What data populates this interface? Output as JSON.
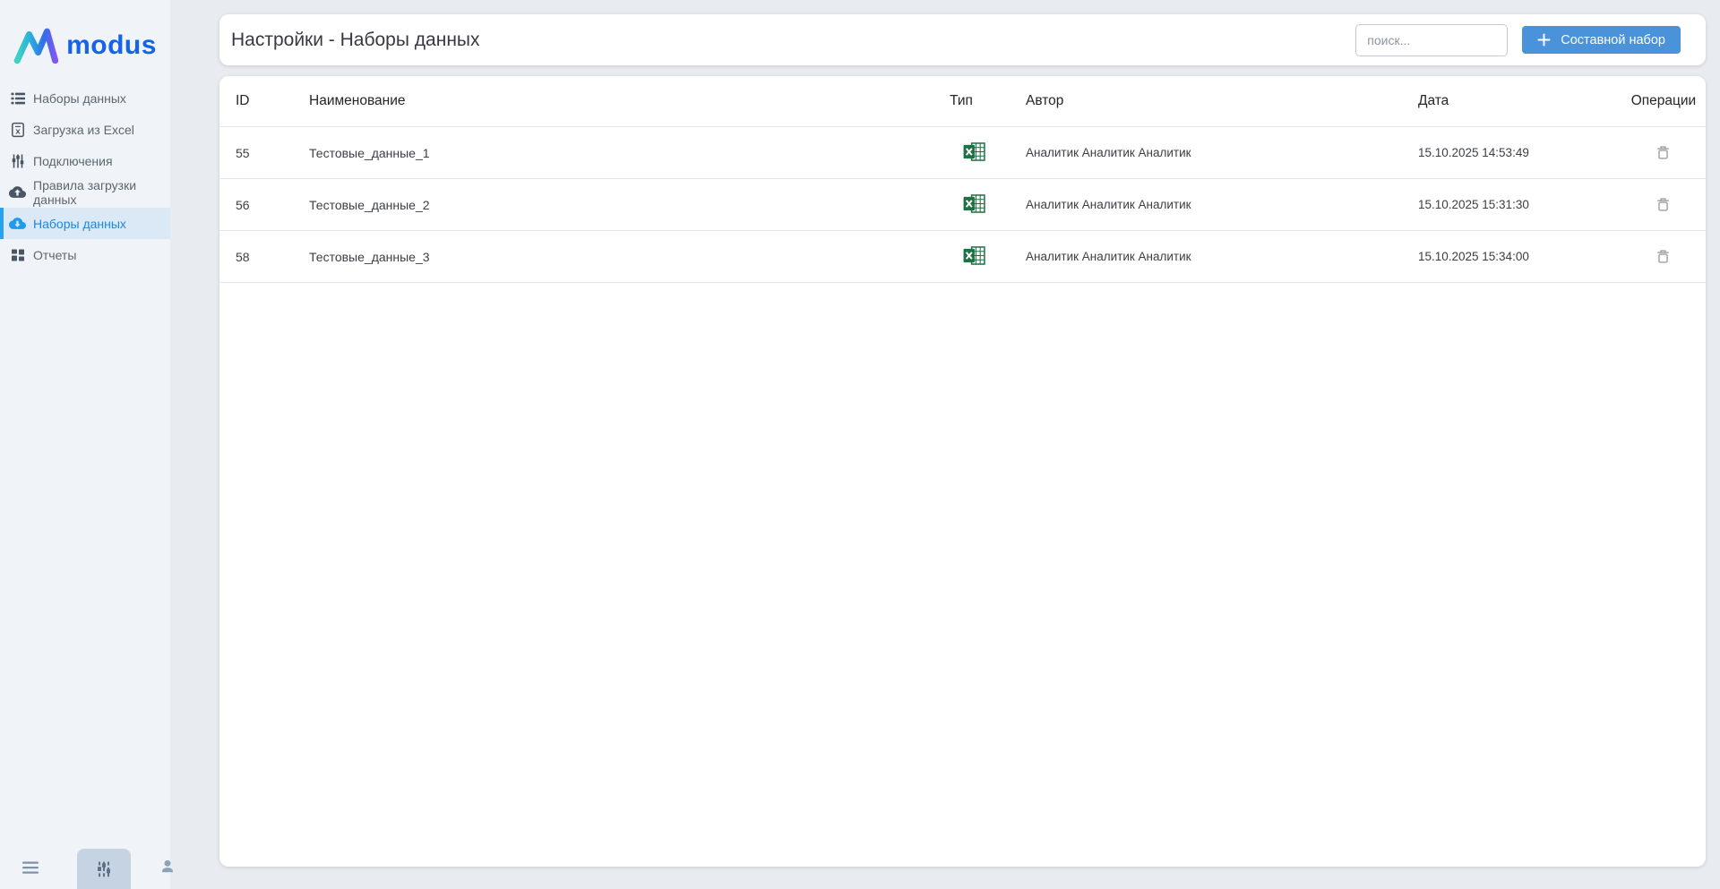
{
  "logo": {
    "brand": "modus"
  },
  "sidebar": {
    "items": [
      {
        "label": "Наборы данных",
        "icon": "list-icon",
        "active": false
      },
      {
        "label": "Загрузка из Excel",
        "icon": "excel-file-icon",
        "active": false
      },
      {
        "label": "Подключения",
        "icon": "sliders-icon",
        "active": false
      },
      {
        "label": "Правила загрузки данных",
        "icon": "cloud-upload-icon",
        "active": false
      },
      {
        "label": "Наборы данных",
        "icon": "cloud-download-icon",
        "active": true
      },
      {
        "label": "Отчеты",
        "icon": "grid-icon",
        "active": false
      }
    ],
    "footer_icons": [
      "hamburger-icon",
      "sliders-icon",
      "user-icon"
    ]
  },
  "header": {
    "title": "Настройки - Наборы данных",
    "search_placeholder": "поиск...",
    "compose_button": "Составной набор"
  },
  "table": {
    "columns": [
      "ID",
      "Наименование",
      "Тип",
      "Автор",
      "Дата",
      "Операции"
    ],
    "rows": [
      {
        "id": "55",
        "name": "Тестовые_данные_1",
        "type": "excel",
        "author": "Аналитик Аналитик Аналитик",
        "date": "15.10.2025 14:53:49"
      },
      {
        "id": "56",
        "name": "Тестовые_данные_2",
        "type": "excel",
        "author": "Аналитик Аналитик Аналитик",
        "date": "15.10.2025 15:31:30"
      },
      {
        "id": "58",
        "name": "Тестовые_данные_3",
        "type": "excel",
        "author": "Аналитик Аналитик Аналитик",
        "date": "15.10.2025 15:34:00"
      }
    ]
  },
  "colors": {
    "accent_blue": "#27a3eb",
    "active_item_text": "#1e87da",
    "active_item_bg": "#dbe9f6",
    "button_blue": "#4a92da",
    "logo_blue": "#1563e9",
    "excel_green": "#217346",
    "sidebar_bg": "#f0f3f7",
    "page_bg": "#e8ecf0"
  }
}
